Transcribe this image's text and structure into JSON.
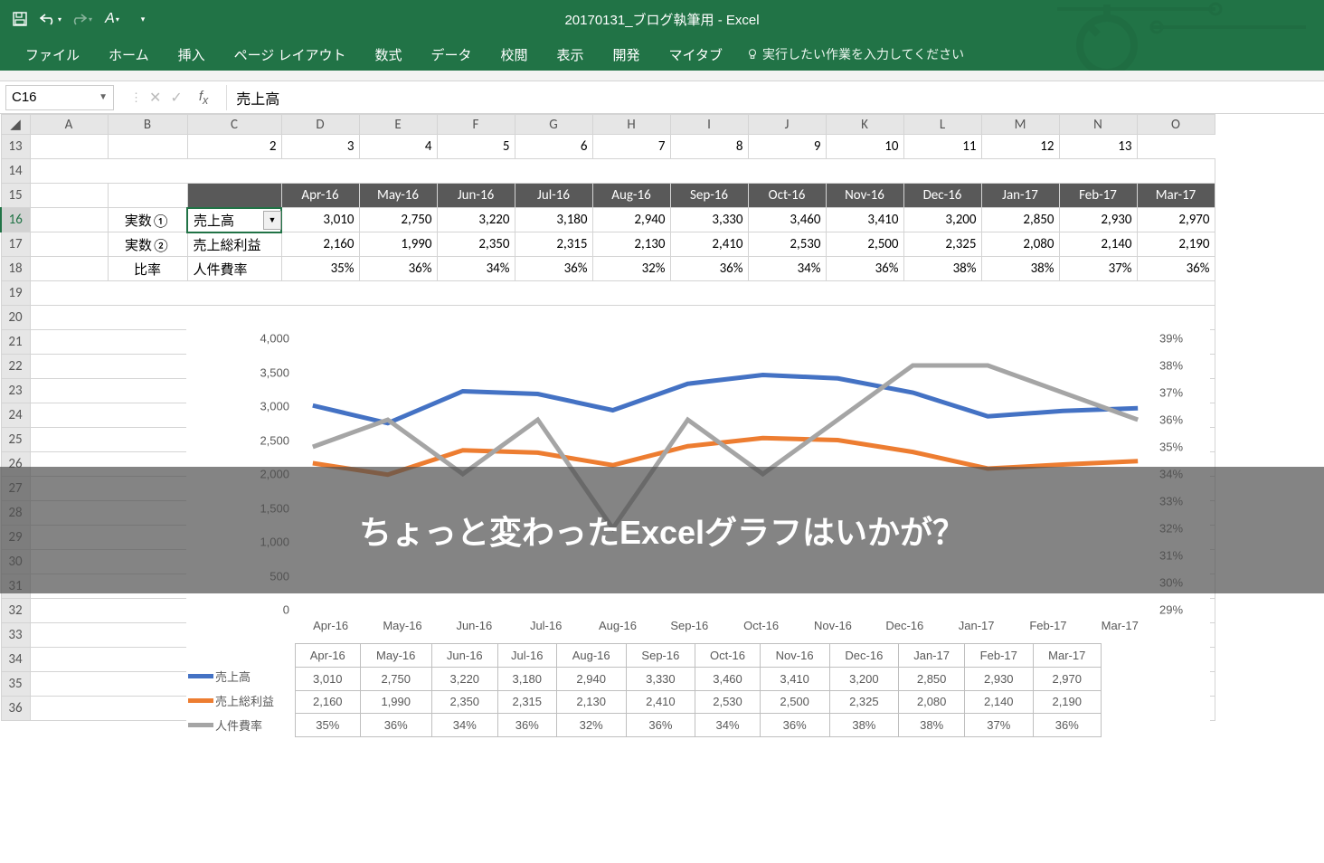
{
  "app": {
    "title": "20170131_ブログ執筆用  -  Excel"
  },
  "ribbon": {
    "tabs": [
      "ファイル",
      "ホーム",
      "挿入",
      "ページ レイアウト",
      "数式",
      "データ",
      "校閲",
      "表示",
      "開発",
      "マイタブ"
    ],
    "tell_me": "実行したい作業を入力してください"
  },
  "namebox": {
    "value": "C16"
  },
  "formula": {
    "value": "売上高"
  },
  "columns": [
    "A",
    "B",
    "C",
    "D",
    "E",
    "F",
    "G",
    "H",
    "I",
    "J",
    "K",
    "L",
    "M",
    "N",
    "O"
  ],
  "row_headers": [
    "13",
    "14",
    "15",
    "16",
    "17",
    "18",
    "19",
    "20",
    "21",
    "22",
    "23",
    "24",
    "25",
    "26",
    "27",
    "28",
    "29",
    "30",
    "31",
    "32",
    "33",
    "34",
    "35",
    "36"
  ],
  "row13_nums": [
    "",
    "",
    "2",
    "3",
    "4",
    "5",
    "6",
    "7",
    "8",
    "9",
    "10",
    "11",
    "12",
    "13"
  ],
  "months": [
    "Apr-16",
    "May-16",
    "Jun-16",
    "Jul-16",
    "Aug-16",
    "Sep-16",
    "Oct-16",
    "Nov-16",
    "Dec-16",
    "Jan-17",
    "Feb-17",
    "Mar-17"
  ],
  "labels": {
    "b16": "実数①",
    "b17": "実数②",
    "b18": "比率",
    "c16": "売上高",
    "c17": "売上総利益",
    "c18": "人件費率"
  },
  "row16": [
    "3,010",
    "2,750",
    "3,220",
    "3,180",
    "2,940",
    "3,330",
    "3,460",
    "3,410",
    "3,200",
    "2,850",
    "2,930",
    "2,970"
  ],
  "row17": [
    "2,160",
    "1,990",
    "2,350",
    "2,315",
    "2,130",
    "2,410",
    "2,530",
    "2,500",
    "2,325",
    "2,080",
    "2,140",
    "2,190"
  ],
  "row18": [
    "35%",
    "36%",
    "34%",
    "36%",
    "32%",
    "36%",
    "34%",
    "36%",
    "38%",
    "38%",
    "37%",
    "36%"
  ],
  "chart_data": {
    "type": "line",
    "categories": [
      "Apr-16",
      "May-16",
      "Jun-16",
      "Jul-16",
      "Aug-16",
      "Sep-16",
      "Oct-16",
      "Nov-16",
      "Dec-16",
      "Jan-17",
      "Feb-17",
      "Mar-17"
    ],
    "series": [
      {
        "name": "売上高",
        "color": "#4472c4",
        "axis": "left",
        "values": [
          3010,
          2750,
          3220,
          3180,
          2940,
          3330,
          3460,
          3410,
          3200,
          2850,
          2930,
          2970
        ]
      },
      {
        "name": "売上総利益",
        "color": "#ed7d31",
        "axis": "left",
        "values": [
          2160,
          1990,
          2350,
          2315,
          2130,
          2410,
          2530,
          2500,
          2325,
          2080,
          2140,
          2190
        ]
      },
      {
        "name": "人件費率",
        "color": "#a5a5a5",
        "axis": "right",
        "values": [
          35,
          36,
          34,
          36,
          32,
          36,
          34,
          36,
          38,
          38,
          37,
          36
        ]
      }
    ],
    "y_left": {
      "min": 0,
      "max": 4000,
      "ticks": [
        "0",
        "500",
        "1,000",
        "1,500",
        "2,000",
        "2,500",
        "3,000",
        "3,500",
        "4,000"
      ]
    },
    "y_right": {
      "min": 29,
      "max": 39,
      "ticks": [
        "29%",
        "30%",
        "31%",
        "32%",
        "33%",
        "34%",
        "35%",
        "36%",
        "37%",
        "38%",
        "39%"
      ]
    },
    "data_table": {
      "header": [
        "Apr-16",
        "May-16",
        "Jun-16",
        "Jul-16",
        "Aug-16",
        "Sep-16",
        "Oct-16",
        "Nov-16",
        "Dec-16",
        "Jan-17",
        "Feb-17",
        "Mar-17"
      ],
      "rows": [
        {
          "label": "売上高",
          "color": "#4472c4",
          "cells": [
            "3,010",
            "2,750",
            "3,220",
            "3,180",
            "2,940",
            "3,330",
            "3,460",
            "3,410",
            "3,200",
            "2,850",
            "2,930",
            "2,970"
          ]
        },
        {
          "label": "売上総利益",
          "color": "#ed7d31",
          "cells": [
            "2,160",
            "1,990",
            "2,350",
            "2,315",
            "2,130",
            "2,410",
            "2,530",
            "2,500",
            "2,325",
            "2,080",
            "2,140",
            "2,190"
          ]
        },
        {
          "label": "人件費率",
          "color": "#a5a5a5",
          "cells": [
            "35%",
            "36%",
            "34%",
            "36%",
            "32%",
            "36%",
            "34%",
            "36%",
            "38%",
            "38%",
            "37%",
            "36%"
          ]
        }
      ]
    }
  },
  "banner": {
    "text": "ちょっと変わったExcelグラフはいかが？"
  }
}
